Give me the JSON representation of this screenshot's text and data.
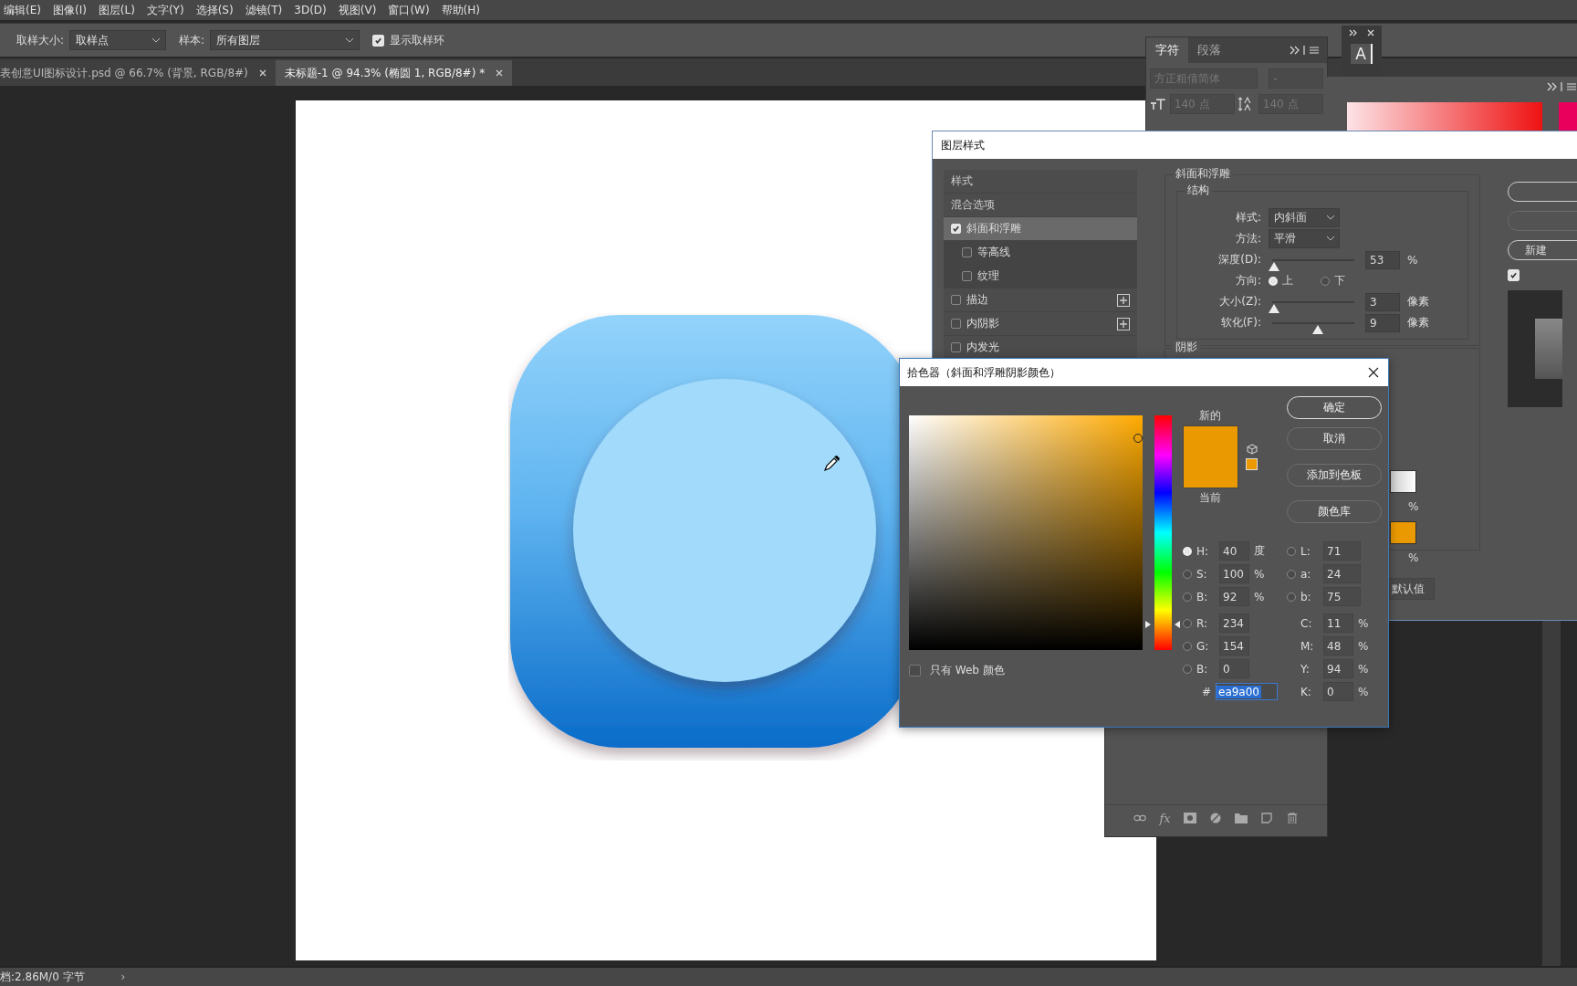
{
  "menu_bar": [
    "编辑(E)",
    "图像(I)",
    "图层(L)",
    "文字(Y)",
    "选择(S)",
    "滤镜(T)",
    "3D(D)",
    "视图(V)",
    "窗口(W)",
    "帮助(H)"
  ],
  "options_bar": {
    "sample_size_label": "取样大小:",
    "sample_size": "取样点",
    "sample_label": "样本:",
    "sample": "所有图层",
    "show_ring": {
      "label": "显示取样环",
      "checked": true
    }
  },
  "tabs": [
    {
      "label": "表创意UI图标设计.psd @ 66.7% (背景, RGB/8#)",
      "selected": false
    },
    {
      "label": "未标题-1 @ 94.3% (椭圆 1, RGB/8#) *",
      "selected": true
    }
  ],
  "character_panel": {
    "tabs": [
      {
        "label": "字符",
        "selected": true
      },
      {
        "label": "段落",
        "selected": false
      }
    ],
    "font": "方正粗倩简体",
    "font_style": "-",
    "size": "140 点",
    "leading": "140 点"
  },
  "glyph_panel": {
    "label": "A"
  },
  "layer_style": {
    "title": "图层样式",
    "styles": [
      {
        "label": "样式",
        "kind": "header"
      },
      {
        "label": "混合选项",
        "kind": "header"
      },
      {
        "label": "斜面和浮雕",
        "kind": "effect",
        "checked": true,
        "selected": true,
        "children": [
          {
            "label": "等高线",
            "checked": false
          },
          {
            "label": "纹理",
            "checked": false
          }
        ]
      },
      {
        "label": "描边",
        "kind": "effect",
        "checked": false,
        "selected": false,
        "addable": true
      },
      {
        "label": "内阴影",
        "kind": "effect",
        "checked": false,
        "selected": false,
        "addable": true
      },
      {
        "label": "内发光",
        "kind": "effect",
        "checked": false,
        "selected": false
      }
    ],
    "section_title": "斜面和浮雕",
    "structure_title": "结构",
    "style_label": "样式:",
    "style_value": "内斜面",
    "method_label": "方法:",
    "method_value": "平滑",
    "depth": {
      "label": "深度(D):",
      "level": 0.02,
      "value": "53",
      "unit": "%"
    },
    "direction": {
      "label": "方向:",
      "options": [
        {
          "label": "上",
          "selected": true
        },
        {
          "label": "下",
          "selected": false
        }
      ]
    },
    "size": {
      "label": "大小(Z):",
      "level": 0.02,
      "value": "3",
      "unit": "像素"
    },
    "soften": {
      "label": "软化(F):",
      "level": 0.56,
      "value": "9",
      "unit": "像素"
    },
    "shadow_title": "阴影",
    "shadow_units": [
      "%",
      "%"
    ],
    "default_button": "默认值",
    "new_style_button": "新建",
    "preview_checked": true
  },
  "layers_panel": {
    "fx_label": "fx"
  },
  "color_picker": {
    "title": "拾色器（斜面和浮雕阴影颜色）",
    "new_label": "新的",
    "current_label": "当前",
    "buttons": [
      {
        "label": "确定",
        "kind": "primary"
      },
      {
        "label": "取消",
        "kind": "normal"
      },
      {
        "label": "添加到色板",
        "kind": "normal"
      },
      {
        "label": "颜色库",
        "kind": "normal"
      }
    ],
    "web_only": {
      "label": "只有 Web 颜色",
      "checked": false
    },
    "fields_left": [
      {
        "label": "H:",
        "value": "40",
        "unit": "度",
        "selected": true
      },
      {
        "label": "S:",
        "value": "100",
        "unit": "%",
        "selected": false
      },
      {
        "label": "B:",
        "value": "92",
        "unit": "%",
        "selected": false
      },
      {
        "label": "R:",
        "value": "234",
        "selected": false
      },
      {
        "label": "G:",
        "value": "154",
        "selected": false
      },
      {
        "label": "B:",
        "value": "0",
        "selected": false
      }
    ],
    "fields_right": [
      {
        "label": "L:",
        "value": "71",
        "selected": false
      },
      {
        "label": "a:",
        "value": "24",
        "selected": false
      },
      {
        "label": "b:",
        "value": "75",
        "selected": false
      },
      {
        "label": "C:",
        "value": "11",
        "unit": "%"
      },
      {
        "label": "M:",
        "value": "48",
        "unit": "%"
      },
      {
        "label": "Y:",
        "value": "94",
        "unit": "%"
      },
      {
        "label": "K:",
        "value": "0",
        "unit": "%"
      }
    ],
    "hue_slider": {
      "level": 0.11
    },
    "hex_label": "#",
    "hex": "ea9a00"
  },
  "status_bar": {
    "text": "档:2.86M/0 字节",
    "arrow": "›"
  }
}
